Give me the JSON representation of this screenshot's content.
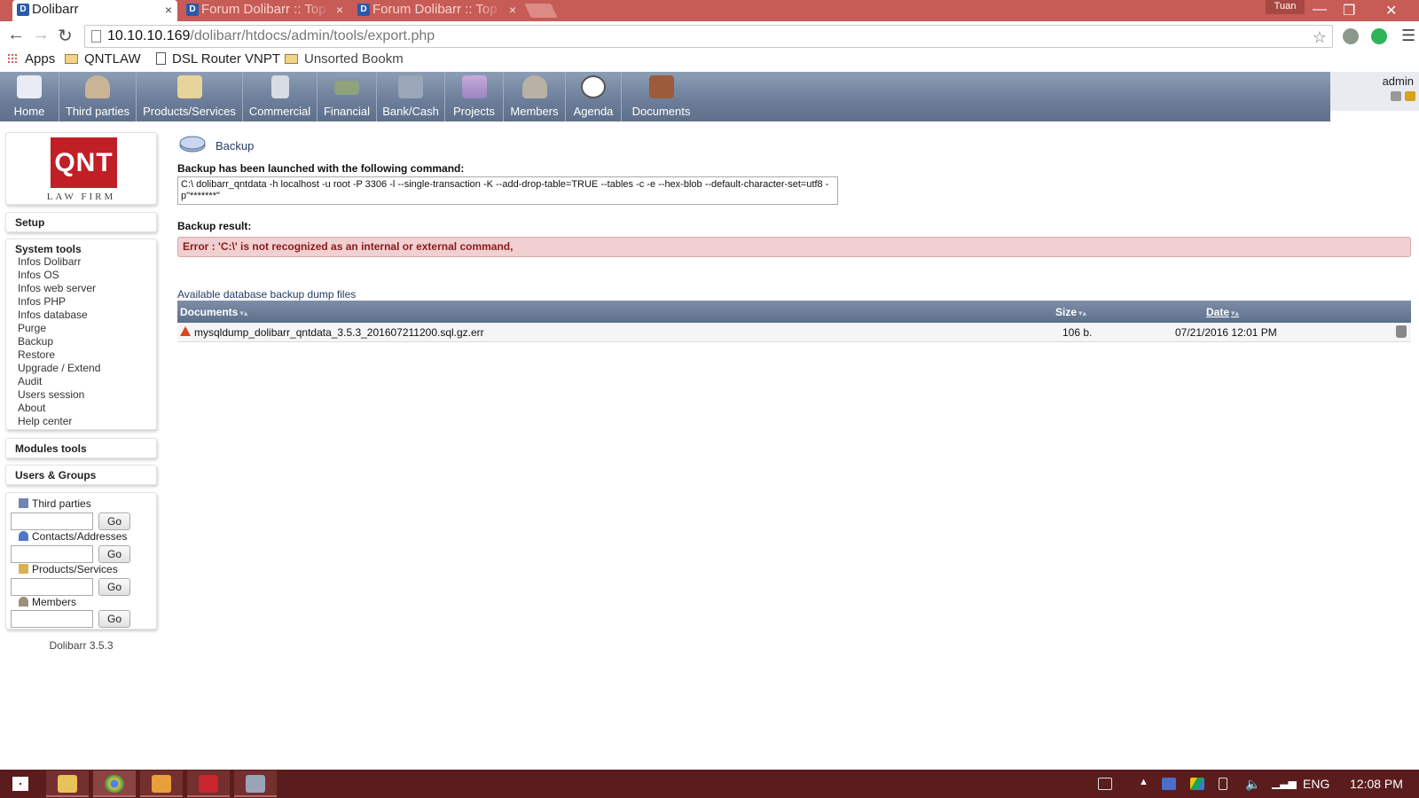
{
  "browser": {
    "tabs": [
      {
        "title": "Dolibarr",
        "close": "×"
      },
      {
        "title": "Forum Dolibarr :: Top",
        "close": "×"
      },
      {
        "title": "Forum Dolibarr :: Top",
        "close": "×"
      }
    ],
    "user_badge": "Tuan",
    "window_controls": {
      "minimize": "—",
      "maximize": "❐",
      "close": "✕"
    },
    "url_host": "10.10.10.169",
    "url_path": "/dolibarr/htdocs/admin/tools/export.php",
    "bookmarks": [
      "Apps",
      "QNTLAW",
      "DSL Router VNPT",
      "Unsorted Bookm"
    ]
  },
  "topmenu": {
    "items": [
      "Home",
      "Third parties",
      "Products/Services",
      "Commercial",
      "Financial",
      "Bank/Cash",
      "Projects",
      "Members",
      "Agenda",
      "Documents"
    ],
    "login": "admin"
  },
  "sidebar": {
    "logo_mark": "QNT",
    "logo_text": "LAW FIRM",
    "setup": "Setup",
    "system_tools": {
      "title": "System tools",
      "items": [
        "Infos Dolibarr",
        "Infos OS",
        "Infos web server",
        "Infos PHP",
        "Infos database",
        "Purge",
        "Backup",
        "Restore",
        "Upgrade / Extend",
        "Audit",
        "Users session",
        "About",
        "Help center"
      ]
    },
    "modules_tools": "Modules tools",
    "users_groups": "Users & Groups",
    "quick_search": {
      "third_parties": "Third parties",
      "contacts": "Contacts/Addresses",
      "products": "Products/Services",
      "members": "Members",
      "go": "Go"
    },
    "version": "Dolibarr 3.5.3"
  },
  "main": {
    "title": "Backup",
    "command_label": "Backup has been launched with the following command:",
    "command": "C:\\ dolibarr_qntdata -h localhost -u root -P 3306 -l --single-transaction -K --add-drop-table=TRUE --tables -c -e --hex-blob --default-character-set=utf8 -p\"*******\"",
    "result_label": "Backup result:",
    "error": "Error : 'C:\\' is not recognized as an internal or external command,",
    "available_label": "Available database backup dump files",
    "table": {
      "headers": {
        "documents": "Documents",
        "size": "Size",
        "date": "Date"
      },
      "rows": [
        {
          "name": "mysqldump_dolibarr_qntdata_3.5.3_201607211200.sql.gz.err",
          "size": "106 b.",
          "date": "07/21/2016 12:01 PM"
        }
      ]
    }
  },
  "taskbar": {
    "language": "ENG",
    "time": "12:08 PM"
  },
  "colors": {
    "menu_bar": "#6b7d98",
    "error_bg": "#f0d0d0",
    "error_text": "#8a1a1a",
    "chrome_frame": "#c75b55",
    "taskbar": "#5a1c1c"
  }
}
